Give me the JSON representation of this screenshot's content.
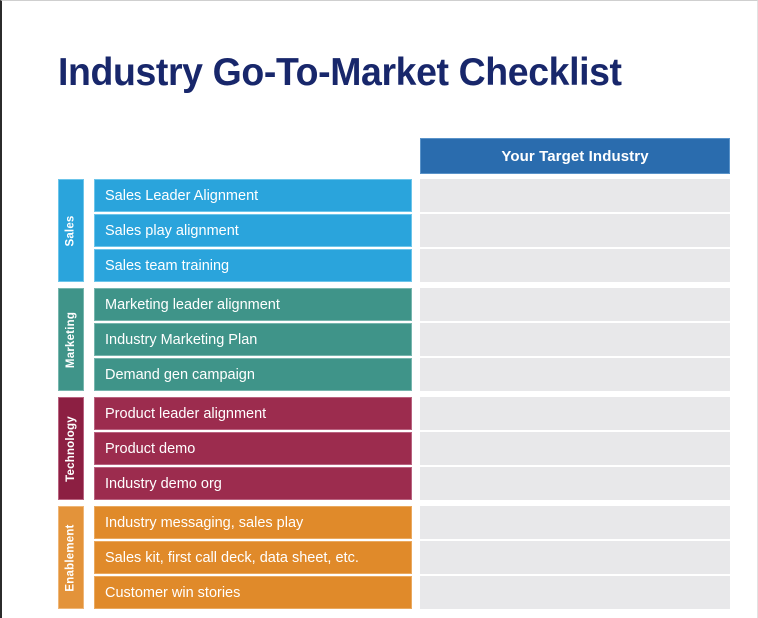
{
  "slide": {
    "title": "Industry Go-To-Market Checklist",
    "background_color": "#ffffff",
    "title_color": "#18276b"
  },
  "table": {
    "column_header": {
      "label": "Your Target Industry",
      "background_color": "#2a6cae",
      "text_color": "#ffffff"
    },
    "answer_cell_color": "#e8e8ea",
    "sections": [
      {
        "name": "Sales",
        "color": "#2aa4dc",
        "tab_color": "#2aa4dc",
        "rows": [
          {
            "label": "Sales Leader Alignment",
            "answer": ""
          },
          {
            "label": "Sales play alignment",
            "answer": ""
          },
          {
            "label": "Sales team training",
            "answer": ""
          }
        ]
      },
      {
        "name": "Marketing",
        "color": "#3f9489",
        "tab_color": "#3f9489",
        "rows": [
          {
            "label": "Marketing leader alignment",
            "answer": ""
          },
          {
            "label": "Industry Marketing Plan",
            "answer": ""
          },
          {
            "label": "Demand gen campaign",
            "answer": ""
          }
        ]
      },
      {
        "name": "Technology",
        "color": "#9c2c4e",
        "tab_color": "#8c1f42",
        "rows": [
          {
            "label": "Product leader alignment",
            "answer": ""
          },
          {
            "label": "Product demo",
            "answer": ""
          },
          {
            "label": "Industry demo org",
            "answer": ""
          }
        ]
      },
      {
        "name": "Enablement",
        "color": "#e08a2a",
        "tab_color": "#e3933a",
        "rows": [
          {
            "label": "Industry messaging, sales play",
            "answer": ""
          },
          {
            "label": "Sales kit, first call deck, data sheet, etc.",
            "answer": ""
          },
          {
            "label": "Customer win stories",
            "answer": ""
          }
        ]
      }
    ]
  }
}
